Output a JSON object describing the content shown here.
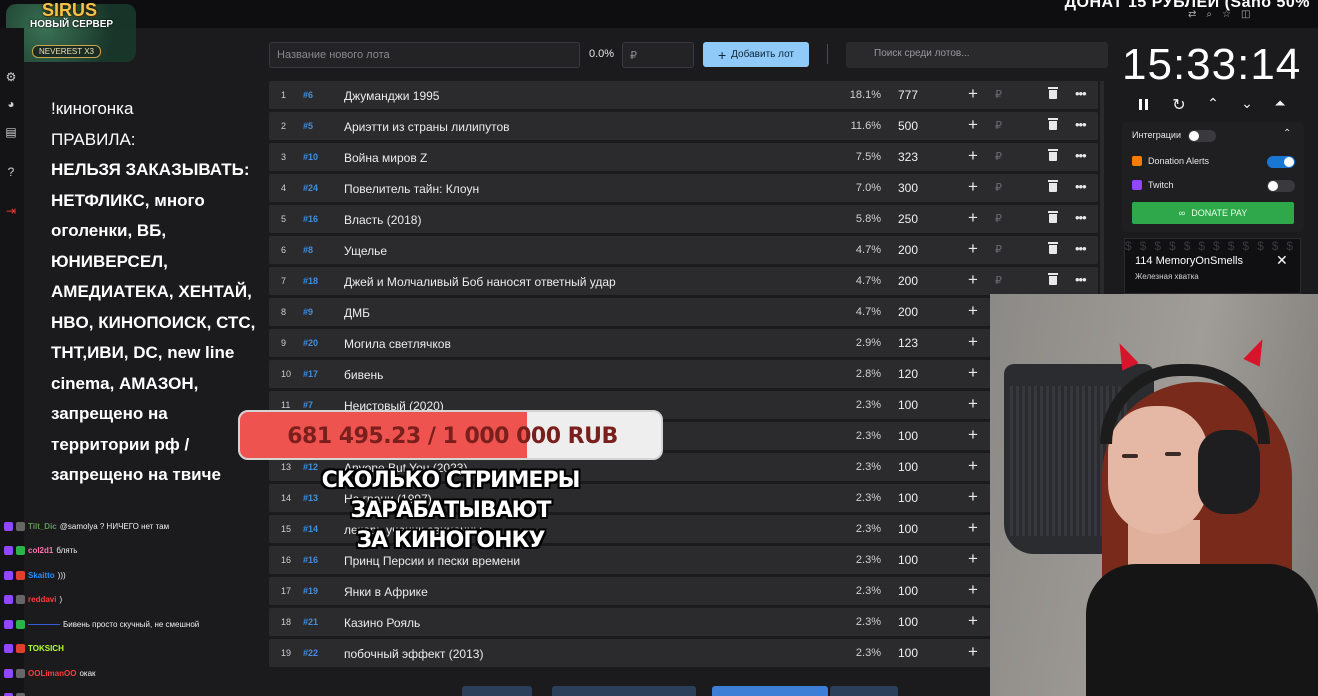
{
  "top_overlay_text": "ДОНАТ 15 РУБЛЕЙ (Saho 50%",
  "logo": {
    "title": "SIRUS",
    "subtitle": "НОВЫЙ СЕРВЕР",
    "badge": "NEVEREST X3"
  },
  "rules": {
    "line1": "!киногонка",
    "line2": "ПРАВИЛА:",
    "body": "НЕЛЬЗЯ ЗАКАЗЫВАТЬ: НЕТФЛИКС, много оголенки, ВБ, ЮНИВЕРСЕЛ, АМЕДИАТЕКА, ХЕНТАЙ, HBO, КИНОПОИСК, СТС, ТНТ,ИВИ, DC, new line cinema, АМАЗОН, запрещено на территории рф / запрещено на твиче"
  },
  "chat": [
    {
      "user": "Tilt_Dic",
      "msg": "@samolya ? НИЧЕГО нет там",
      "color": "#5a9a4a"
    },
    {
      "user": "col2d1",
      "msg": "блять",
      "color": "#ff6fae"
    },
    {
      "user": "Skaitto",
      "msg": ")))",
      "color": "#1e90ff"
    },
    {
      "user": "reddavi",
      "msg": ")",
      "color": "#ff3b3b"
    },
    {
      "user": "————",
      "msg": "Бивень просто скучный, не смешной",
      "color": "#3b6cff"
    },
    {
      "user": "TOKSICH",
      "msg": "",
      "color": "#b6ff3b"
    },
    {
      "user": "OOLimanOO",
      "msg": "окак",
      "color": "#ff3b3b"
    },
    {
      "user": "—",
      "msg": "",
      "color": "#3b6cff"
    }
  ],
  "toolbar": {
    "new_lot_placeholder": "Название нового лота",
    "percent": "0.0%",
    "amount_placeholder": "₽",
    "add_button": "Добавить лот",
    "search_placeholder": "Поиск среди лотов..."
  },
  "lots": [
    {
      "rank": "1",
      "id": "#6",
      "name": "Джуманджи 1995",
      "pct": "18.1%",
      "amount": "777"
    },
    {
      "rank": "2",
      "id": "#5",
      "name": "Ариэтти из страны лилипутов",
      "pct": "11.6%",
      "amount": "500"
    },
    {
      "rank": "3",
      "id": "#10",
      "name": "Война миров Z",
      "pct": "7.5%",
      "amount": "323"
    },
    {
      "rank": "4",
      "id": "#24",
      "name": "Повелитель тайн: Клоун",
      "pct": "7.0%",
      "amount": "300"
    },
    {
      "rank": "5",
      "id": "#16",
      "name": "Власть (2018)",
      "pct": "5.8%",
      "amount": "250"
    },
    {
      "rank": "6",
      "id": "#8",
      "name": "Ущелье",
      "pct": "4.7%",
      "amount": "200"
    },
    {
      "rank": "7",
      "id": "#18",
      "name": "Джей и Молчаливый Боб наносят ответный удар",
      "pct": "4.7%",
      "amount": "200"
    },
    {
      "rank": "8",
      "id": "#9",
      "name": "ДМБ",
      "pct": "4.7%",
      "amount": "200"
    },
    {
      "rank": "9",
      "id": "#20",
      "name": "Могила светлячков",
      "pct": "2.9%",
      "amount": "123"
    },
    {
      "rank": "10",
      "id": "#17",
      "name": "бивень",
      "pct": "2.8%",
      "amount": "120"
    },
    {
      "rank": "11",
      "id": "#7",
      "name": "Неистовый (2020)",
      "pct": "2.3%",
      "amount": "100"
    },
    {
      "rank": "12",
      "id": "",
      "name": "",
      "pct": "2.3%",
      "amount": "100"
    },
    {
      "rank": "13",
      "id": "#12",
      "name": "Anyone But You (2023)",
      "pct": "2.3%",
      "amount": "100"
    },
    {
      "rank": "14",
      "id": "#13",
      "name": "На грани (1997)",
      "pct": "2.3%",
      "amount": "100"
    },
    {
      "rank": "15",
      "id": "#14",
      "name": "лекарь ученик авиценны",
      "pct": "2.3%",
      "amount": "100"
    },
    {
      "rank": "16",
      "id": "#16",
      "name": "Принц Персии и пески времени",
      "pct": "2.3%",
      "amount": "100"
    },
    {
      "rank": "17",
      "id": "#19",
      "name": "Янки в Африке",
      "pct": "2.3%",
      "amount": "100"
    },
    {
      "rank": "18",
      "id": "#21",
      "name": "Казино Рояль",
      "pct": "2.3%",
      "amount": "100"
    },
    {
      "rank": "19",
      "id": "#22",
      "name": "побочный эффект (2013)",
      "pct": "2.3%",
      "amount": "100"
    }
  ],
  "row_icons": {
    "plus": "+",
    "currency": "₽",
    "more": "•••"
  },
  "timer": {
    "value": "15:33:14"
  },
  "integrations": {
    "title": "Интеграции",
    "donation_alerts": "Donation Alerts",
    "twitch": "Twitch",
    "donate_button": "DONATE PAY"
  },
  "alert": {
    "name": "114 MemoryOnSmells",
    "message": "Железная хватка",
    "dollars": "$$$$$$$$$$$$$$$$$$$$$$$$$$$$$$$$$$$$$$$$"
  },
  "progress": {
    "text": "681 495.23 / 1 000 000 RUB",
    "fraction": 0.681
  },
  "caption": {
    "line1": "СКОЛЬКО СТРИМЕРЫ ЗАРАБАТЫВАЮТ",
    "line2": "ЗА КИНОГОНКУ"
  },
  "colors": {
    "accent_button": "#90caf9",
    "progress_fill": "#ef5350",
    "donate_green": "#2ea84a",
    "id_blue": "#3f8fe0"
  }
}
